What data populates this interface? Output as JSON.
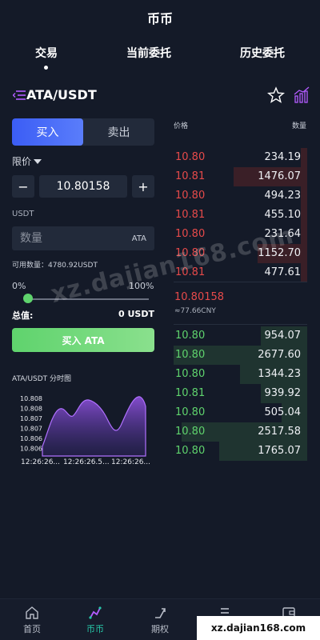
{
  "app": {
    "title": "币币"
  },
  "tabs": [
    {
      "label": "交易"
    },
    {
      "label": "当前委托"
    },
    {
      "label": "历史委托"
    }
  ],
  "pair": {
    "name": "ATA/USDT",
    "icons": [
      "menu-icon",
      "star-icon",
      "chart-icon"
    ]
  },
  "trade": {
    "buy_label": "买入",
    "sell_label": "卖出",
    "order_type": "限价",
    "price_value": "10.80158",
    "minus_label": "−",
    "plus_label": "+",
    "unit_label": "USDT",
    "qty_placeholder": "数量",
    "qty_unit": "ATA",
    "available": "可用数量：4780.92USDT",
    "pct_min": "0%",
    "pct_max": "100%",
    "slider_value": 0,
    "total_label": "总值:",
    "total_value": "0 USDT",
    "submit_label": "买入 ATA"
  },
  "mini_chart": {
    "title": "ATA/USDT 分时图",
    "y_ticks": [
      "10.808",
      "10.808",
      "10.807",
      "10.807",
      "10.806",
      "10.806"
    ],
    "x_ticks": [
      "12:26:26...",
      "12:26:26.5...",
      "12:26:26..."
    ]
  },
  "orderbook": {
    "price_header": "价格",
    "qty_header": "数量",
    "asks": [
      {
        "price": "10.80",
        "qty": "234.19",
        "depth": 0.05
      },
      {
        "price": "10.81",
        "qty": "1476.07",
        "depth": 0.55
      },
      {
        "price": "10.80",
        "qty": "494.23",
        "depth": 0.05
      },
      {
        "price": "10.81",
        "qty": "455.10",
        "depth": 0.05
      },
      {
        "price": "10.80",
        "qty": "231.64",
        "depth": 0.05
      },
      {
        "price": "10.80",
        "qty": "1152.70",
        "depth": 0.37
      },
      {
        "price": "10.81",
        "qty": "477.61",
        "depth": 0.05
      }
    ],
    "last_price": "10.80158",
    "last_cny": "≈77.66CNY",
    "bids": [
      {
        "price": "10.80",
        "qty": "954.07",
        "depth": 0.35
      },
      {
        "price": "10.80",
        "qty": "2677.60",
        "depth": 1.0
      },
      {
        "price": "10.80",
        "qty": "1344.23",
        "depth": 0.5
      },
      {
        "price": "10.81",
        "qty": "939.92",
        "depth": 0.35
      },
      {
        "price": "10.80",
        "qty": "505.04",
        "depth": 0.19
      },
      {
        "price": "10.80",
        "qty": "2517.58",
        "depth": 0.94
      },
      {
        "price": "10.80",
        "qty": "1765.07",
        "depth": 0.66
      }
    ]
  },
  "watermark": "xz.dajian168.com",
  "nav": [
    {
      "label": "首页",
      "icon": "home-icon",
      "active": false
    },
    {
      "label": "币币",
      "icon": "coin-trade-icon",
      "active": true
    },
    {
      "label": "期权",
      "icon": "options-icon",
      "active": false
    },
    {
      "label": "",
      "icon": "list-icon",
      "active": false
    },
    {
      "label": "",
      "icon": "wallet-icon",
      "active": false
    }
  ],
  "url_banner": "xz.dajian168.com",
  "colors": {
    "ask": "#e64a4a",
    "bid": "#5fd36d",
    "accent": "#3b5df5",
    "nav_active": "#27c7a8",
    "background": "#141a28"
  }
}
